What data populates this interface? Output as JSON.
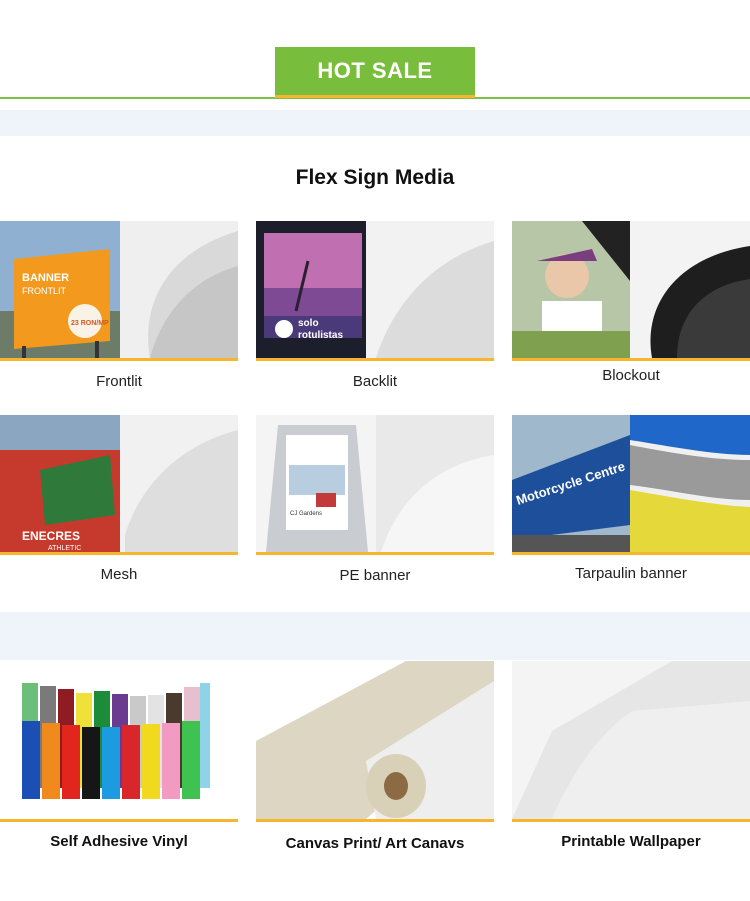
{
  "header": {
    "hot_sale": "HOT SALE"
  },
  "section": {
    "title": "Flex Sign Media"
  },
  "flex_products": [
    {
      "label": "Frontlit",
      "photo_text": [
        "BANNER",
        "FRONTLIT",
        "23 RON/MP"
      ]
    },
    {
      "label": "Backlit",
      "photo_text": [
        "solo",
        "rotulistas"
      ]
    },
    {
      "label": "Blockout"
    },
    {
      "label": "Mesh",
      "photo_text": [
        "ENECRES",
        "ATHLETIC"
      ]
    },
    {
      "label": "PE banner",
      "photo_text": [
        "CJ Gardens"
      ]
    },
    {
      "label": "Tarpaulin banner",
      "photo_text": [
        "Motorcycle Centre"
      ]
    }
  ],
  "other_products": [
    {
      "label": "Self Adhesive Vinyl"
    },
    {
      "label": "Canvas Print/ Art Canavs"
    },
    {
      "label": "Printable Wallpaper"
    }
  ],
  "colors": {
    "accent_green": "#79bd3c",
    "accent_orange": "#f6b52d",
    "band": "#eef4fa"
  }
}
